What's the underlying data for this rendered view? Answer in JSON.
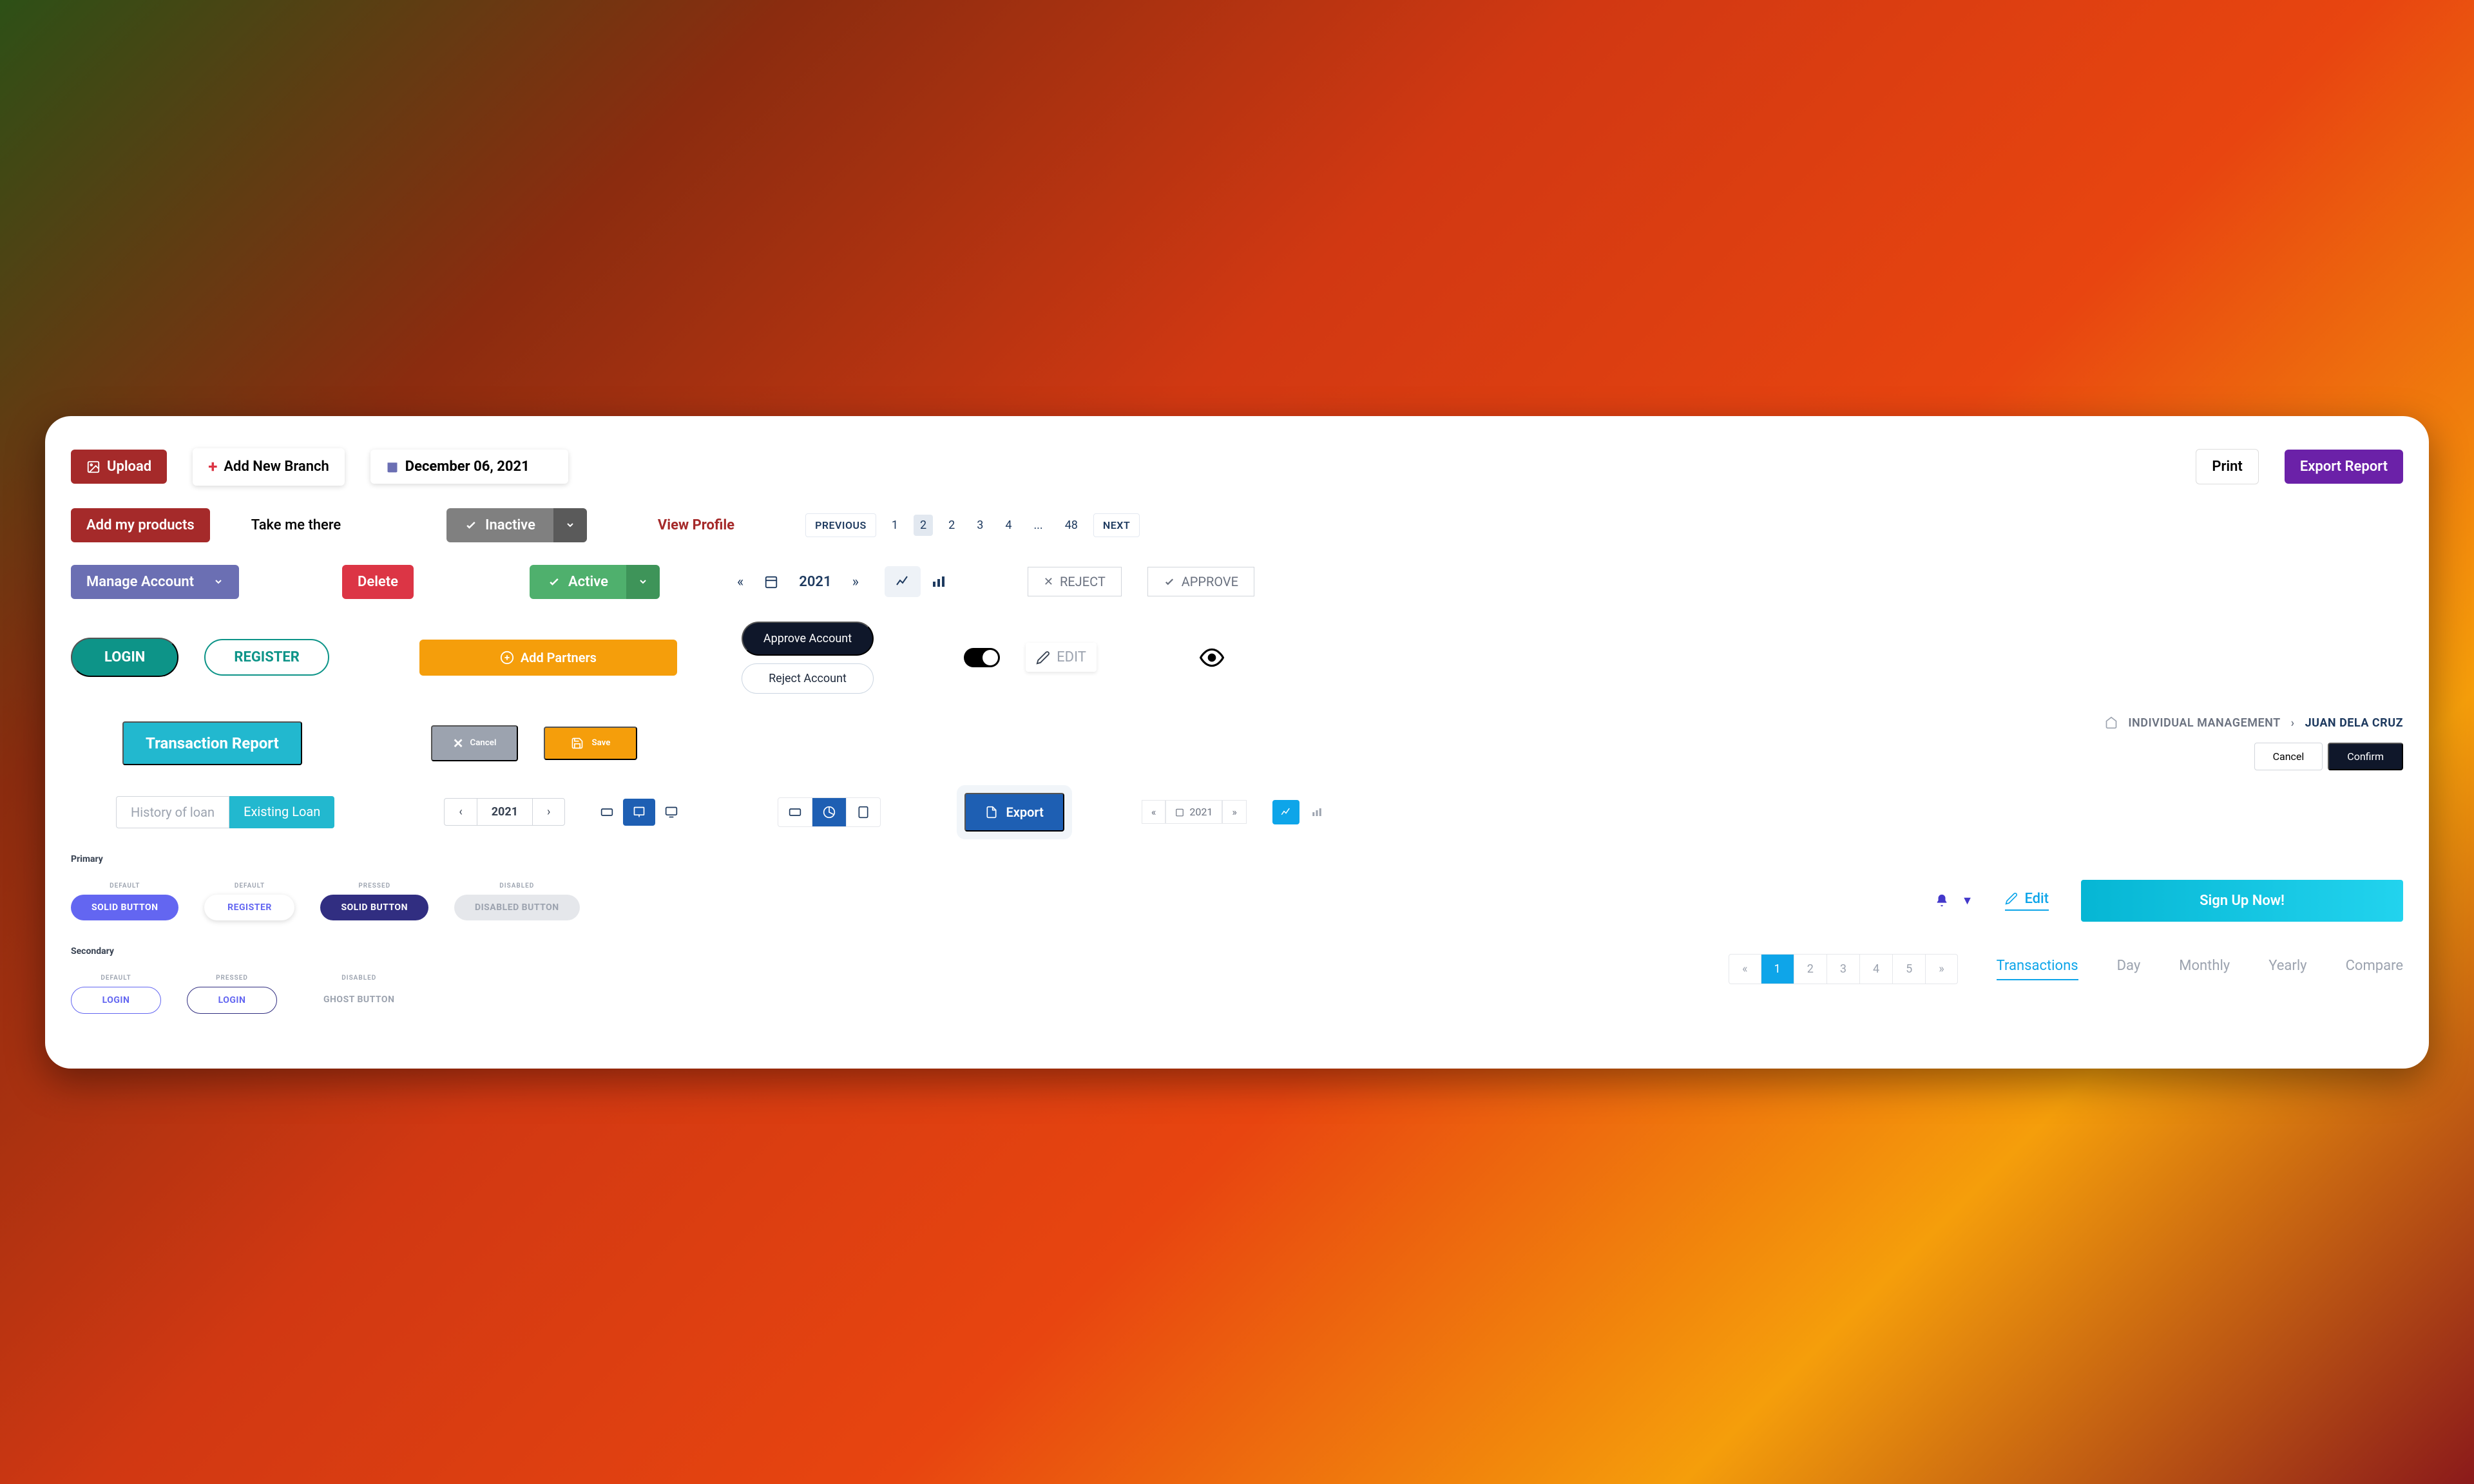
{
  "row1": {
    "upload": "Upload",
    "add_branch": "Add New Branch",
    "date": "December 06, 2021",
    "print": "Print",
    "export_report": "Export Report"
  },
  "row2": {
    "add_products": "Add my products",
    "take_me": "Take me there",
    "inactive": "Inactive",
    "view_profile": "View Profile",
    "previous": "PREVIOUS",
    "next": "NEXT",
    "pages": [
      "1",
      "2",
      "2",
      "3",
      "4",
      "...",
      "48"
    ]
  },
  "row3": {
    "manage": "Manage Account",
    "delete": "Delete",
    "active": "Active",
    "year": "2021",
    "reject": "REJECT",
    "approve": "APPROVE"
  },
  "row4": {
    "login": "LOGIN",
    "register": "REGISTER",
    "add_partners": "Add Partners",
    "approve_acct": "Approve Account",
    "reject_acct": "Reject Account",
    "edit": "EDIT"
  },
  "row5": {
    "report": "Transaction Report",
    "cancel": "Cancel",
    "save": "Save",
    "bc1": "INDIVIDUAL MANAGEMENT",
    "bc2": "JUAN DELA CRUZ",
    "cancel_sm": "Cancel",
    "confirm_sm": "Confirm"
  },
  "row6": {
    "history": "History of loan",
    "existing": "Existing Loan",
    "year": "2021",
    "export": "Export",
    "year2": "2021"
  },
  "demo": {
    "primary_label": "Primary",
    "secondary_label": "Secondary",
    "states": {
      "default": "DEFAULT",
      "pressed": "PRESSED",
      "disabled": "DISABLED"
    },
    "solid": "SOLID BUTTON",
    "register": "REGISTER",
    "disabled": "DISABLED BUTTON",
    "login": "LOGIN",
    "ghost": "GHOST BUTTON"
  },
  "row7": {
    "edit": "Edit",
    "signup": "Sign Up Now!"
  },
  "row8": {
    "pages": [
      "«",
      "1",
      "2",
      "3",
      "4",
      "5",
      "»"
    ],
    "tabs": [
      "Transactions",
      "Day",
      "Monthly",
      "Yearly",
      "Compare"
    ]
  }
}
